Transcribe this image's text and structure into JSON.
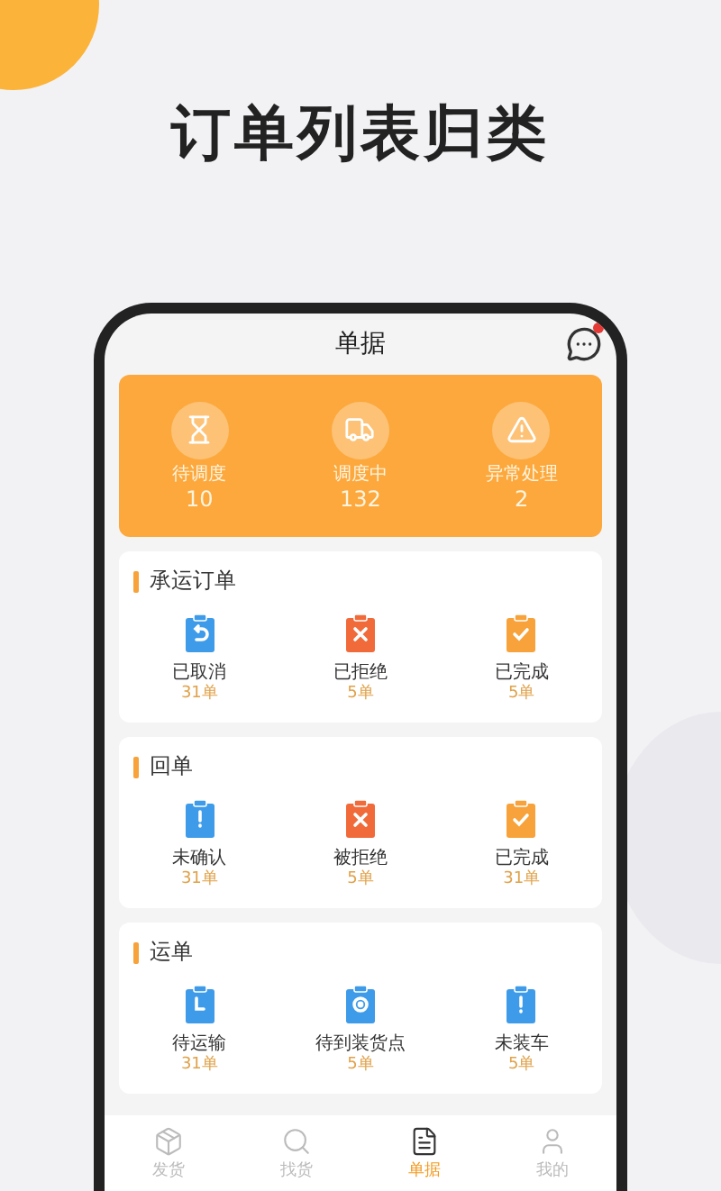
{
  "headline": "订单列表归类",
  "header": {
    "title": "单据",
    "unread": true
  },
  "stats": [
    {
      "kind": "hourglass",
      "label": "待调度",
      "count": "10"
    },
    {
      "kind": "truck",
      "label": "调度中",
      "count": "132"
    },
    {
      "kind": "alert",
      "label": "异常处理",
      "count": "2"
    }
  ],
  "sections": [
    {
      "title": "承运订单",
      "items": [
        {
          "label": "已取消",
          "count": "31单",
          "color": "#3d9be9",
          "kind": "undo"
        },
        {
          "label": "已拒绝",
          "count": "5单",
          "color": "#f06a3a",
          "kind": "cross"
        },
        {
          "label": "已完成",
          "count": "5单",
          "color": "#f7a23a",
          "kind": "check"
        }
      ]
    },
    {
      "title": "回单",
      "items": [
        {
          "label": "未确认",
          "count": "31单",
          "color": "#3d9be9",
          "kind": "alert"
        },
        {
          "label": "被拒绝",
          "count": "5单",
          "color": "#f06a3a",
          "kind": "cross"
        },
        {
          "label": "已完成",
          "count": "31单",
          "color": "#f7a23a",
          "kind": "check"
        }
      ]
    },
    {
      "title": "运单",
      "items": [
        {
          "label": "待运输",
          "count": "31单",
          "color": "#3d9be9",
          "kind": "clock"
        },
        {
          "label": "待到装货点",
          "count": "5单",
          "color": "#3d9be9",
          "kind": "pin"
        },
        {
          "label": "未装车",
          "count": "5单",
          "color": "#3d9be9",
          "kind": "alert"
        }
      ]
    }
  ],
  "tabs": [
    {
      "kind": "box",
      "label": "发货",
      "selected": false
    },
    {
      "kind": "search",
      "label": "找货",
      "selected": false
    },
    {
      "kind": "doc",
      "label": "单据",
      "selected": true
    },
    {
      "kind": "user",
      "label": "我的",
      "selected": false
    }
  ]
}
